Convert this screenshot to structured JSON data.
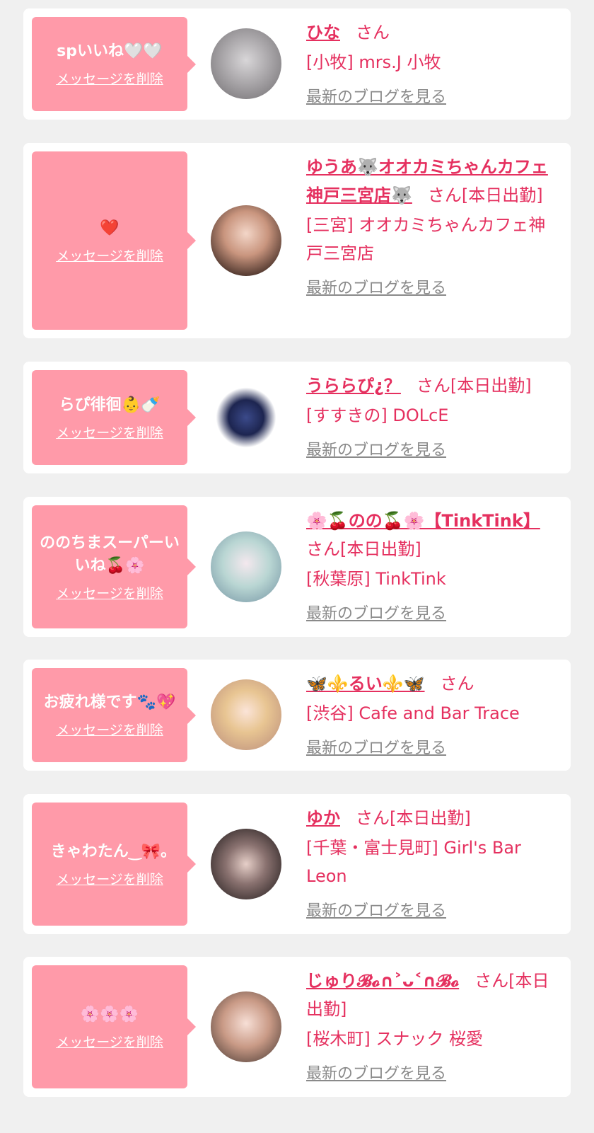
{
  "delete_label": "メッセージを削除",
  "blog_label": "最新のブログを見る",
  "colors": {
    "accent": "#e5305f",
    "bubble": "#ff9aa9",
    "background": "#f0f0f0",
    "muted": "#8a8a8a"
  },
  "cards": [
    {
      "message": "spいいね🤍🤍",
      "name": "ひな",
      "suffix": "さん",
      "area_shop": "[小牧] mrs.J 小牧",
      "avatar": "avatar-photo"
    },
    {
      "message": "❤️",
      "name": "ゆうあ🐺オオカミちゃんカフェ神戸三宮店🐺",
      "suffix": "さん[本日出勤]",
      "area_shop": "[三宮] オオカミちゃんカフェ神戸三宮店",
      "avatar": "avatar-photo"
    },
    {
      "message": "らぴ徘徊👶🍼",
      "name": "うららぴ¿？",
      "suffix": "さん[本日出勤]",
      "area_shop": "[すすきの] DOLcE",
      "avatar": "avatar-photo"
    },
    {
      "message": "ののちまスーパーいいね🍒🌸",
      "name": "🌸🍒のの🍒🌸【TinkTink】",
      "suffix": "さん[本日出勤]",
      "area_shop": "[秋葉原] TinkTink",
      "avatar": "avatar-photo"
    },
    {
      "message": "お疲れ様です🐾💖",
      "name": "🦋⚜️るい⚜️🦋",
      "suffix": "さん",
      "area_shop": "[渋谷] Cafe and Bar Trace",
      "avatar": "avatar-photo"
    },
    {
      "message": "きゃわたん‿🎀｡",
      "name": "ゆか",
      "suffix": "さん[本日出勤]",
      "area_shop": "[千葉・富士見町] Girl's Bar Leon",
      "avatar": "avatar-photo"
    },
    {
      "message": "🌸🌸🌸",
      "name": "じゅり𝓑𝓸∩˃ᴗ˂∩𝓑𝓸",
      "suffix": "さん[本日出勤]",
      "area_shop": "[桜木町] スナック 桜愛",
      "avatar": "avatar-photo"
    }
  ]
}
